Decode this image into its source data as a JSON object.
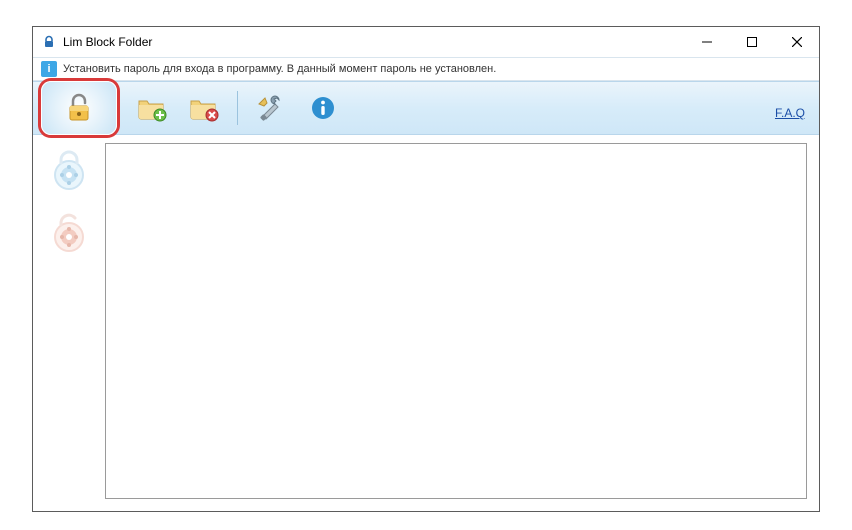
{
  "window": {
    "title": "Lim Block Folder"
  },
  "infobar": {
    "message": "Установить пароль для входа в программу. В данный момент пароль не установлен."
  },
  "toolbar": {
    "buttons": {
      "lock": "lock-folder",
      "add_folder": "add-folder",
      "remove_folder": "remove-folder",
      "settings": "settings",
      "about": "about"
    },
    "faq": "F.A.Q"
  },
  "sidebar": {
    "lock_all": "lock-all",
    "unlock_all": "unlock-all"
  }
}
